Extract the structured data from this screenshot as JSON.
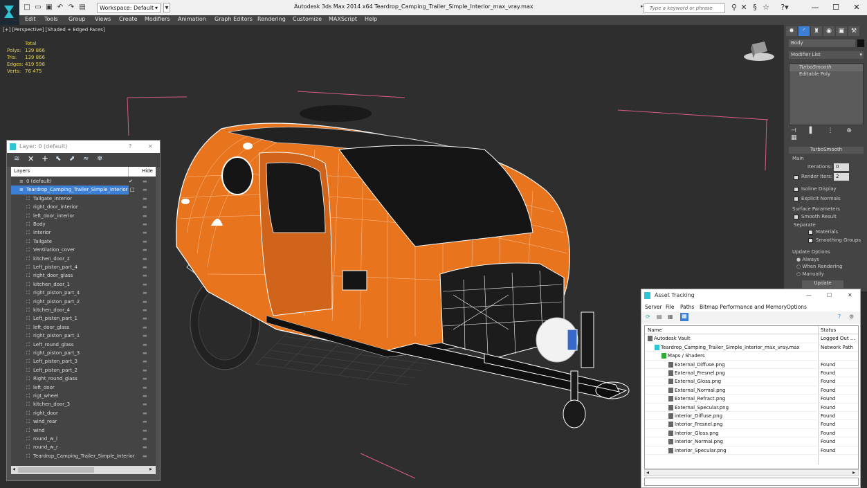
{
  "window": {
    "title": "Autodesk 3ds Max  2014 x64     Teardrop_Camping_Trailer_Simple_Interior_max_vray.max",
    "workspace": "Workspace: Default",
    "search_placeholder": "Type a keyword or phrase"
  },
  "menu": [
    "Edit",
    "Tools",
    "Group",
    "Views",
    "Create",
    "Modifiers",
    "Animation",
    "Graph Editors",
    "Rendering",
    "Customize",
    "MAXScript",
    "Help"
  ],
  "viewport": {
    "label": "[+] [Perspective] [Shaded + Edged Faces]",
    "stats": {
      "total_label": "Total",
      "rows": [
        {
          "label": "Polys:",
          "value": "139 866"
        },
        {
          "label": "Tris:",
          "value": "139 866"
        },
        {
          "label": "Edges:",
          "value": "419 598"
        },
        {
          "label": "Verts:",
          "value": "76 475"
        }
      ]
    }
  },
  "layer_panel": {
    "title": "Layer: 0 (default)",
    "help": "?",
    "close": "✕",
    "col_layers": "Layers",
    "col_hide": "Hide",
    "items": [
      {
        "name": "0 (default)",
        "level": 0,
        "kind": "layer"
      },
      {
        "name": "Teardrop_Camping_Trailer_Simple_Interior",
        "level": 0,
        "kind": "layer-selected"
      },
      {
        "name": "Tailgate_interior",
        "level": 1
      },
      {
        "name": "right_door_interior",
        "level": 1
      },
      {
        "name": "left_door_interior",
        "level": 1
      },
      {
        "name": "Body",
        "level": 1
      },
      {
        "name": "Interior",
        "level": 1
      },
      {
        "name": "Tailgate",
        "level": 1
      },
      {
        "name": "Ventilation_cover",
        "level": 1
      },
      {
        "name": "kitchen_door_2",
        "level": 1
      },
      {
        "name": "Left_piston_part_4",
        "level": 1
      },
      {
        "name": "right_door_glass",
        "level": 1
      },
      {
        "name": "kitchen_door_1",
        "level": 1
      },
      {
        "name": "right_piston_part_4",
        "level": 1
      },
      {
        "name": "right_piston_part_2",
        "level": 1
      },
      {
        "name": "kitchen_door_4",
        "level": 1
      },
      {
        "name": "Left_piston_part_1",
        "level": 1
      },
      {
        "name": "left_door_glass",
        "level": 1
      },
      {
        "name": "right_piston_part_1",
        "level": 1
      },
      {
        "name": "Left_round_glass",
        "level": 1
      },
      {
        "name": "right_piston_part_3",
        "level": 1
      },
      {
        "name": "Left_piston_part_3",
        "level": 1
      },
      {
        "name": "Left_piston_part_2",
        "level": 1
      },
      {
        "name": "Right_round_glass",
        "level": 1
      },
      {
        "name": "left_door",
        "level": 1
      },
      {
        "name": "rigt_wheel",
        "level": 1
      },
      {
        "name": "kitchen_door_3",
        "level": 1
      },
      {
        "name": "right_door",
        "level": 1
      },
      {
        "name": "wind_rear",
        "level": 1
      },
      {
        "name": "wind",
        "level": 1
      },
      {
        "name": "round_w_l",
        "level": 1
      },
      {
        "name": "round_w_r",
        "level": 1
      },
      {
        "name": "Teardrop_Camping_Trailer_Simple_Interior",
        "level": 1
      }
    ]
  },
  "command_panel": {
    "object_name": "Body",
    "modifier_list": "Modifier List",
    "stack": [
      "TurboSmooth",
      "Editable Poly"
    ],
    "rollout_title": "TurboSmooth",
    "main_label": "Main",
    "iterations_label": "Iterations:",
    "iterations_value": "0",
    "render_iters_label": "Render Iters:",
    "render_iters_value": "2",
    "isoline_label": "Isoline Display",
    "explicit_label": "Explicit Normals",
    "surface_label": "Surface Parameters",
    "smooth_result_label": "Smooth Result",
    "separate_label": "Separate",
    "materials_label": "Materials",
    "smoothing_groups_label": "Smoothing Groups",
    "update_options_label": "Update Options",
    "always_label": "Always",
    "when_rendering_label": "When Rendering",
    "manually_label": "Manually",
    "update_button": "Update"
  },
  "asset_tracking": {
    "title": "Asset Tracking",
    "menu": [
      "Server",
      "File",
      "Paths",
      "Bitmap Performance and Memory",
      "Options"
    ],
    "col_name": "Name",
    "col_status": "Status",
    "rows": [
      {
        "name": "Autodesk Vault",
        "status": "Logged Out ...",
        "indent": 0
      },
      {
        "name": "Teardrop_Camping_Trailer_Simple_Interior_max_vray.max",
        "status": "Network Path",
        "indent": 1
      },
      {
        "name": "Maps / Shaders",
        "status": "",
        "indent": 2
      },
      {
        "name": "External_Diffuse.png",
        "status": "Found",
        "indent": 3
      },
      {
        "name": "External_Fresnel.png",
        "status": "Found",
        "indent": 3
      },
      {
        "name": "External_Gloss.png",
        "status": "Found",
        "indent": 3
      },
      {
        "name": "External_Normal.png",
        "status": "Found",
        "indent": 3
      },
      {
        "name": "External_Refract.png",
        "status": "Found",
        "indent": 3
      },
      {
        "name": "External_Specular.png",
        "status": "Found",
        "indent": 3
      },
      {
        "name": "interior_Diffuse.png",
        "status": "Found",
        "indent": 3
      },
      {
        "name": "Interior_Fresnel.png",
        "status": "Found",
        "indent": 3
      },
      {
        "name": "Interior_Gloss.png",
        "status": "Found",
        "indent": 3
      },
      {
        "name": "Interior_Normal.png",
        "status": "Found",
        "indent": 3
      },
      {
        "name": "Interior_Specular.png",
        "status": "Found",
        "indent": 3
      }
    ]
  },
  "colors": {
    "trailer_orange": "#e8741e",
    "selection_blue": "#3b80d6",
    "stats_yellow": "#e8d24a",
    "viewport_bg": "#2e2e2e"
  }
}
